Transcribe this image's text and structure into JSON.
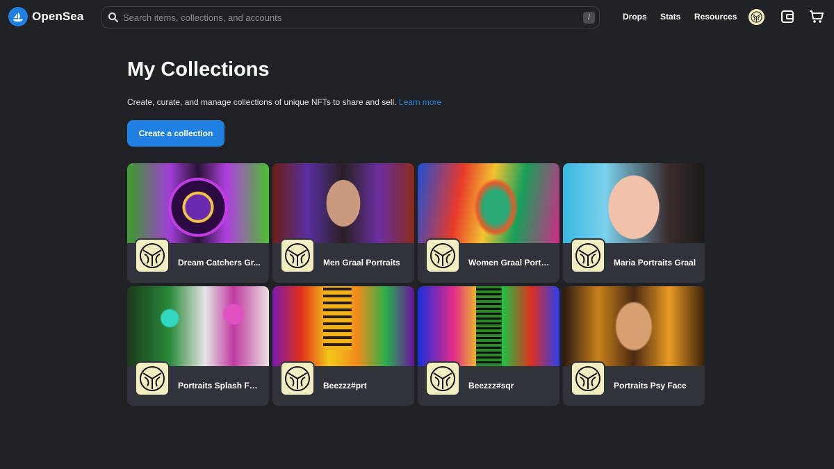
{
  "header": {
    "brand": "OpenSea",
    "search_placeholder": "Search items, collections, and accounts",
    "search_shortcut": "/",
    "links": [
      "Drops",
      "Stats",
      "Resources"
    ]
  },
  "main": {
    "title": "My Collections",
    "subtitle": "Create, curate, and manage collections of unique NFTs to share and sell.",
    "learn_more": "Learn more",
    "create_button": "Create a collection"
  },
  "collections": [
    {
      "name": "Dream Catchers Gr..."
    },
    {
      "name": "Men Graal Portraits"
    },
    {
      "name": "Women Graal Portra..."
    },
    {
      "name": "Maria Portraits Graal"
    },
    {
      "name": "Portraits Splash Fac..."
    },
    {
      "name": "Beezzz#prt"
    },
    {
      "name": "Beezzz#sqr"
    },
    {
      "name": "Portraits Psy Face"
    }
  ],
  "colors": {
    "background": "#202225",
    "card": "#303339",
    "accent": "#2081e2",
    "avatar": "#f3eec2"
  },
  "icons": {
    "logo": "opensea-boat-icon",
    "search": "search-icon",
    "wallet": "wallet-icon",
    "cart": "cart-icon",
    "profile": "profile-avatar"
  }
}
